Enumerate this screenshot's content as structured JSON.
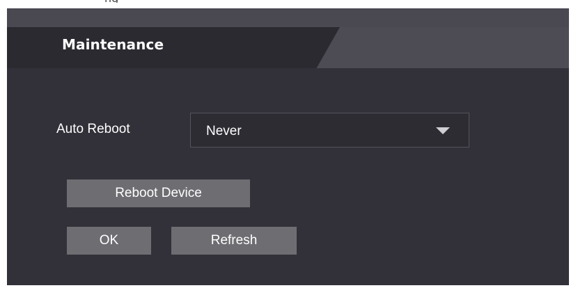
{
  "top_fragment_text": "ng",
  "tab": {
    "title": "Maintenance"
  },
  "auto_reboot": {
    "label": "Auto Reboot",
    "selected": "Never"
  },
  "buttons": {
    "reboot_device": "Reboot Device",
    "ok": "OK",
    "refresh": "Refresh"
  },
  "colors": {
    "panel_bg": "#323139",
    "tab_bg": "#2b2a31",
    "tab_right_bg": "#4d4c55",
    "button_bg": "#6e6d72",
    "text": "#ffffff"
  },
  "icons": {
    "dropdown": "caret-down-icon"
  }
}
